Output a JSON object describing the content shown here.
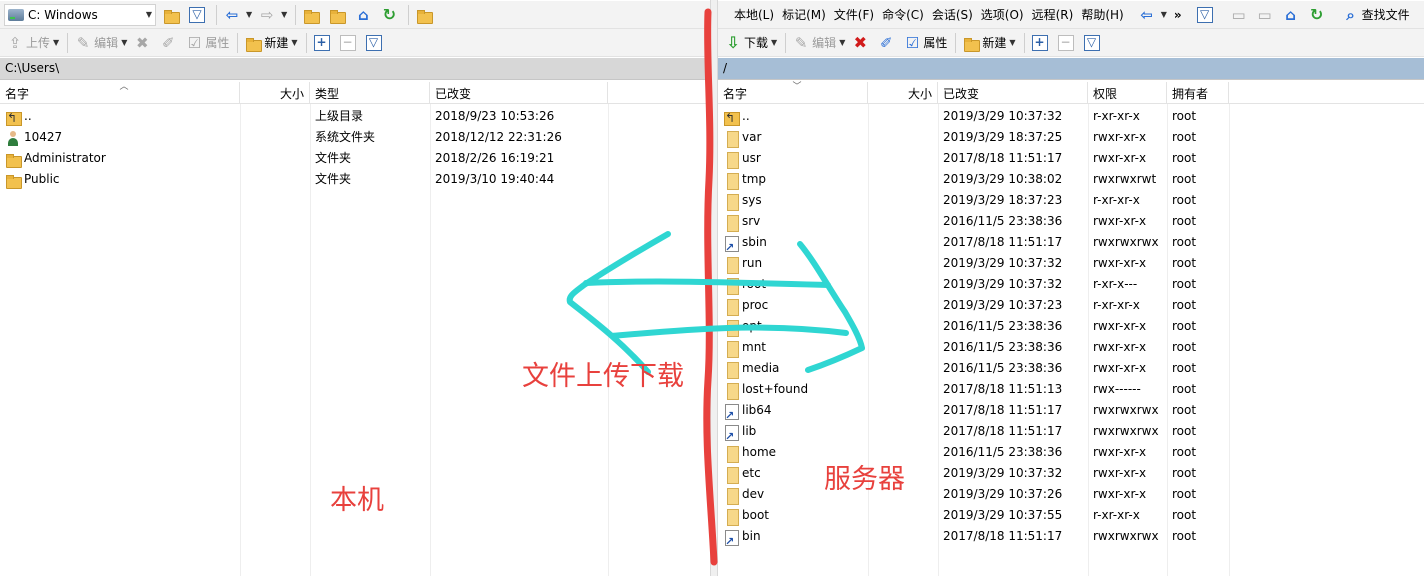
{
  "left": {
    "toolbar1": {
      "drive_label": "C: Windows"
    },
    "toolbar2": {
      "upload": "上传",
      "edit": "编辑",
      "properties": "属性",
      "new": "新建"
    },
    "path": "C:\\Users\\",
    "headers": {
      "name": "名字",
      "size": "大小",
      "type": "类型",
      "modified": "已改变"
    },
    "rows": [
      {
        "icon": "parent-dir",
        "name": "..",
        "size": "",
        "type": "上级目录",
        "modified": "2018/9/23  10:53:26"
      },
      {
        "icon": "user-folder",
        "name": "10427",
        "size": "",
        "type": "系统文件夹",
        "modified": "2018/12/12  22:31:26"
      },
      {
        "icon": "folder",
        "name": "Administrator",
        "size": "",
        "type": "文件夹",
        "modified": "2018/2/26  16:19:21"
      },
      {
        "icon": "folder",
        "name": "Public",
        "size": "",
        "type": "文件夹",
        "modified": "2019/3/10  19:40:44"
      }
    ]
  },
  "right": {
    "menu": [
      "本地(L)",
      "标记(M)",
      "文件(F)",
      "命令(C)",
      "会话(S)",
      "选项(O)",
      "远程(R)",
      "帮助(H)"
    ],
    "find_files": "查找文件",
    "toolbar2": {
      "download": "下载",
      "edit": "编辑",
      "properties": "属性",
      "new": "新建"
    },
    "path": "/",
    "headers": {
      "name": "名字",
      "size": "大小",
      "modified": "已改变",
      "rights": "权限",
      "owner": "拥有者"
    },
    "rows": [
      {
        "icon": "parent-dir",
        "name": "..",
        "size": "",
        "modified": "2019/3/29 10:37:32",
        "rights": "r-xr-xr-x",
        "owner": "root"
      },
      {
        "icon": "folder",
        "name": "var",
        "size": "",
        "modified": "2019/3/29 18:37:25",
        "rights": "rwxr-xr-x",
        "owner": "root"
      },
      {
        "icon": "folder",
        "name": "usr",
        "size": "",
        "modified": "2017/8/18 11:51:17",
        "rights": "rwxr-xr-x",
        "owner": "root"
      },
      {
        "icon": "folder",
        "name": "tmp",
        "size": "",
        "modified": "2019/3/29 10:38:02",
        "rights": "rwxrwxrwt",
        "owner": "root"
      },
      {
        "icon": "folder",
        "name": "sys",
        "size": "",
        "modified": "2019/3/29 18:37:23",
        "rights": "r-xr-xr-x",
        "owner": "root"
      },
      {
        "icon": "folder",
        "name": "srv",
        "size": "",
        "modified": "2016/11/5 23:38:36",
        "rights": "rwxr-xr-x",
        "owner": "root"
      },
      {
        "icon": "link",
        "name": "sbin",
        "size": "",
        "modified": "2017/8/18 11:51:17",
        "rights": "rwxrwxrwx",
        "owner": "root"
      },
      {
        "icon": "folder",
        "name": "run",
        "size": "",
        "modified": "2019/3/29 10:37:32",
        "rights": "rwxr-xr-x",
        "owner": "root"
      },
      {
        "icon": "folder",
        "name": "root",
        "size": "",
        "modified": "2019/3/29 10:37:32",
        "rights": "r-xr-x---",
        "owner": "root"
      },
      {
        "icon": "folder",
        "name": "proc",
        "size": "",
        "modified": "2019/3/29 10:37:23",
        "rights": "r-xr-xr-x",
        "owner": "root"
      },
      {
        "icon": "folder",
        "name": "opt",
        "size": "",
        "modified": "2016/11/5 23:38:36",
        "rights": "rwxr-xr-x",
        "owner": "root"
      },
      {
        "icon": "folder",
        "name": "mnt",
        "size": "",
        "modified": "2016/11/5 23:38:36",
        "rights": "rwxr-xr-x",
        "owner": "root"
      },
      {
        "icon": "folder",
        "name": "media",
        "size": "",
        "modified": "2016/11/5 23:38:36",
        "rights": "rwxr-xr-x",
        "owner": "root"
      },
      {
        "icon": "folder",
        "name": "lost+found",
        "size": "",
        "modified": "2017/8/18 11:51:13",
        "rights": "rwx------",
        "owner": "root"
      },
      {
        "icon": "link",
        "name": "lib64",
        "size": "",
        "modified": "2017/8/18 11:51:17",
        "rights": "rwxrwxrwx",
        "owner": "root"
      },
      {
        "icon": "link",
        "name": "lib",
        "size": "",
        "modified": "2017/8/18 11:51:17",
        "rights": "rwxrwxrwx",
        "owner": "root"
      },
      {
        "icon": "folder",
        "name": "home",
        "size": "",
        "modified": "2016/11/5 23:38:36",
        "rights": "rwxr-xr-x",
        "owner": "root"
      },
      {
        "icon": "folder",
        "name": "etc",
        "size": "",
        "modified": "2019/3/29 10:37:32",
        "rights": "rwxr-xr-x",
        "owner": "root"
      },
      {
        "icon": "folder",
        "name": "dev",
        "size": "",
        "modified": "2019/3/29 10:37:26",
        "rights": "rwxr-xr-x",
        "owner": "root"
      },
      {
        "icon": "folder",
        "name": "boot",
        "size": "",
        "modified": "2019/3/29 10:37:55",
        "rights": "r-xr-xr-x",
        "owner": "root"
      },
      {
        "icon": "link",
        "name": "bin",
        "size": "",
        "modified": "2017/8/18 11:51:17",
        "rights": "rwxrwxrwx",
        "owner": "root"
      }
    ]
  },
  "annotations": {
    "transfer_label": "文件上传下载",
    "local_label": "本机",
    "server_label": "服务器",
    "line_color": "#e8413d",
    "arrow_color": "#2fd6d2"
  }
}
